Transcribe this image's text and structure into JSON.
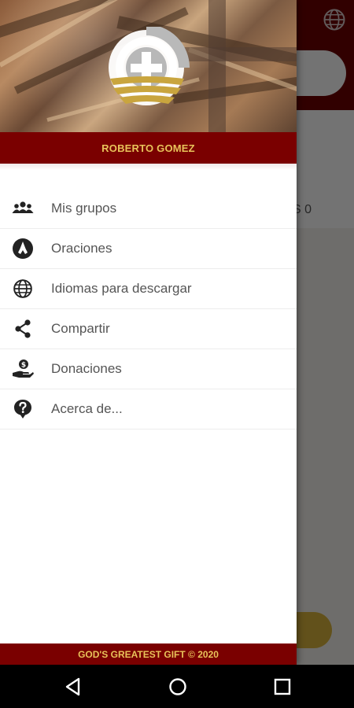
{
  "drawer": {
    "user_name": "ROBERTO GOMEZ",
    "footer": "GOD'S GREATEST GIFT © 2020",
    "menu": [
      {
        "label": "Mis grupos",
        "icon": "group-icon"
      },
      {
        "label": "Oraciones",
        "icon": "praying-hands-icon"
      },
      {
        "label": "Idiomas para descargar",
        "icon": "globe-icon"
      },
      {
        "label": "Compartir",
        "icon": "share-icon"
      },
      {
        "label": "Donaciones",
        "icon": "donation-hand-icon"
      },
      {
        "label": "Acerca de...",
        "icon": "help-icon"
      }
    ]
  },
  "background": {
    "card_text": "S 0"
  },
  "colors": {
    "brand_dark_red": "#7a0000",
    "brand_gold": "#e8c35a",
    "text_gray": "#555555"
  }
}
